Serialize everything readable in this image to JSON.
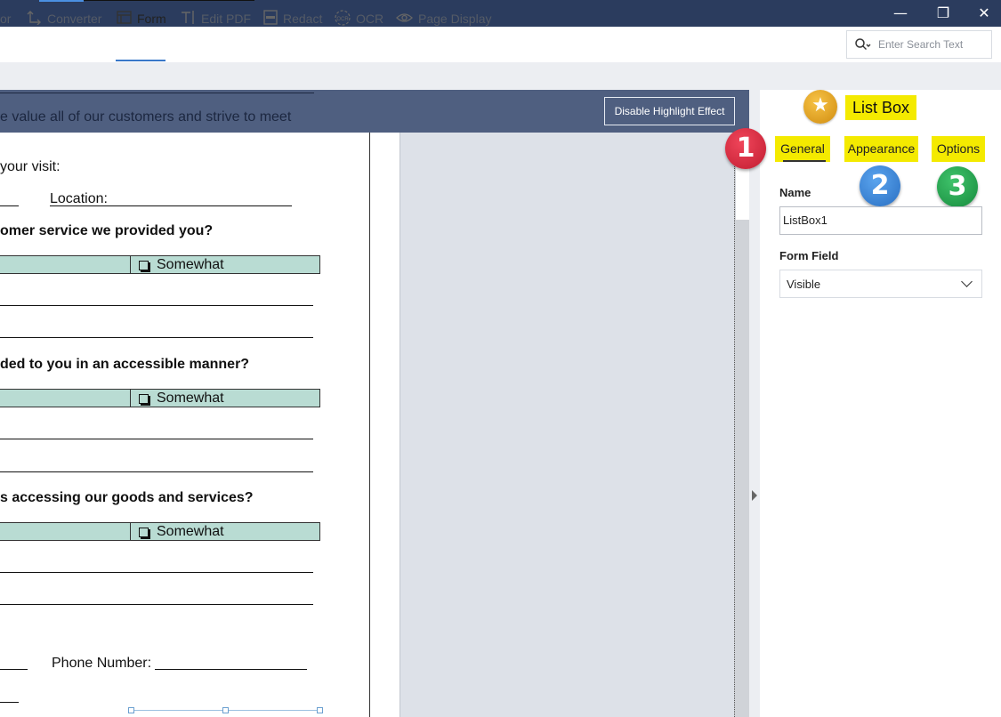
{
  "window": {
    "minimize_glyph": "—",
    "restore_glyph": "❐",
    "close_glyph": "✕"
  },
  "toolbar": {
    "items": [
      {
        "label": "or",
        "icon": "editor-icon"
      },
      {
        "label": "Converter",
        "icon": "converter-icon"
      },
      {
        "label": "Form",
        "icon": "form-icon"
      },
      {
        "label": "Edit PDF",
        "icon": "edit-text-icon"
      },
      {
        "label": "Redact",
        "icon": "redact-icon"
      },
      {
        "label": "OCR",
        "icon": "ocr-icon"
      },
      {
        "label": "Page Display",
        "icon": "eye-icon"
      }
    ],
    "active": "Form"
  },
  "search": {
    "placeholder": "Enter Search Text"
  },
  "banner": {
    "text": "e value all of our customers and strive to meet",
    "highlight_button": "Disable Highlight Effect"
  },
  "document": {
    "visit_prompt": "your visit:",
    "location_label": "Location:",
    "q1": "omer service we provided you?",
    "q2": "ded to you in an accessible manner?",
    "q3": "s accessing our goods and services?",
    "somewhat": "Somewhat",
    "phone_label": "Phone Number:"
  },
  "panel": {
    "title": "List Box",
    "tabs": [
      "General",
      "Appearance",
      "Options"
    ],
    "active_tab": "General",
    "callouts": [
      "1",
      "2",
      "3"
    ],
    "name_label": "Name",
    "name_value": "ListBox1",
    "form_field_label": "Form Field",
    "form_field_value": "Visible"
  },
  "colors": {
    "titlebar": "#2b3c5e",
    "highlight_yellow": "#f4ea00",
    "callout_red": "#d8283c",
    "callout_blue": "#3a84d6",
    "callout_green": "#21a34e",
    "answer_fill": "#b9dcd3"
  }
}
